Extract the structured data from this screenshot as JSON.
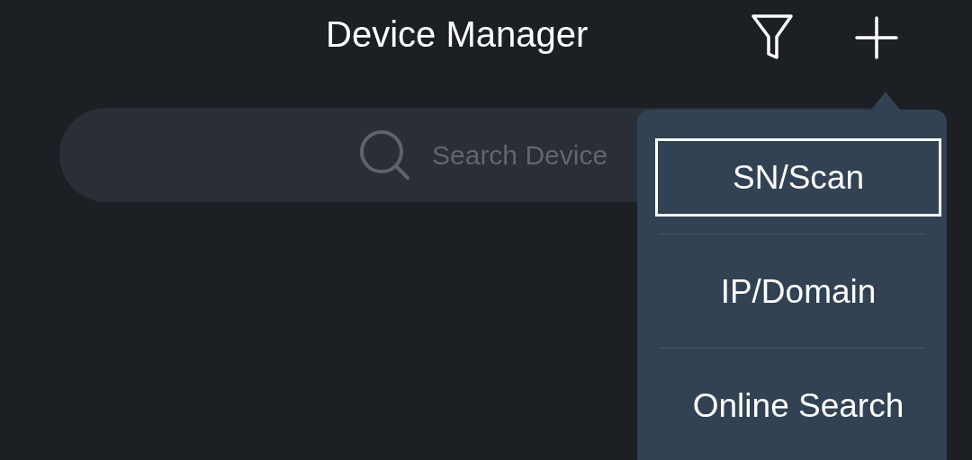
{
  "header": {
    "title": "Device Manager"
  },
  "search": {
    "placeholder": "Search Device"
  },
  "add_menu": {
    "items": [
      {
        "label": "SN/Scan",
        "selected": true
      },
      {
        "label": "IP/Domain",
        "selected": false
      },
      {
        "label": "Online Search",
        "selected": false
      }
    ]
  }
}
